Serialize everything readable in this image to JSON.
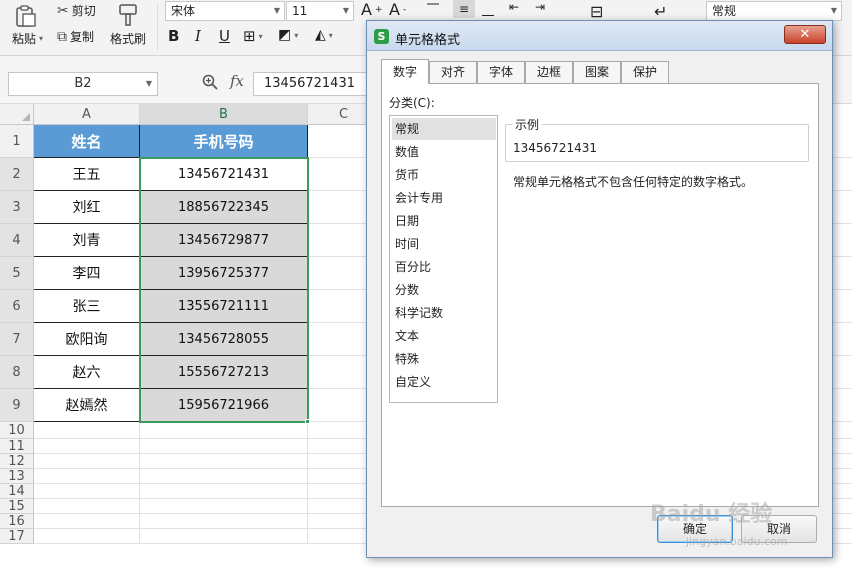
{
  "ribbon": {
    "paste": "粘贴",
    "cut": "剪切",
    "copy": "复制",
    "format_painter": "格式刷",
    "font_name": "宋体",
    "font_size": "11",
    "number_format": "常规"
  },
  "formula_bar": {
    "name_box": "B2",
    "fx": "fx",
    "value": "13456721431"
  },
  "columns": [
    "A",
    "B",
    "C"
  ],
  "rows": [
    "1",
    "2",
    "3",
    "4",
    "5",
    "6",
    "7",
    "8",
    "9",
    "10",
    "11",
    "12",
    "13",
    "14",
    "15",
    "16",
    "17"
  ],
  "table": {
    "headers": [
      "姓名",
      "手机号码"
    ],
    "rows": [
      [
        "王五",
        "13456721431"
      ],
      [
        "刘红",
        "18856722345"
      ],
      [
        "刘青",
        "13456729877"
      ],
      [
        "李四",
        "13956725377"
      ],
      [
        "张三",
        "13556721111"
      ],
      [
        "欧阳询",
        "13456728055"
      ],
      [
        "赵六",
        "15556727213"
      ],
      [
        "赵嫣然",
        "15956721966"
      ]
    ]
  },
  "dialog": {
    "title": "单元格格式",
    "close": "✕",
    "tabs": [
      "数字",
      "对齐",
      "字体",
      "边框",
      "图案",
      "保护"
    ],
    "category_label": "分类(C):",
    "categories": [
      "常规",
      "数值",
      "货币",
      "会计专用",
      "日期",
      "时间",
      "百分比",
      "分数",
      "科学记数",
      "文本",
      "特殊",
      "自定义"
    ],
    "sample_label": "示例",
    "sample_value": "13456721431",
    "description": "常规单元格格式不包含任何特定的数字格式。",
    "ok": "确定",
    "cancel": "取消"
  },
  "watermark": {
    "text": "Baidu 经验",
    "url": "jingyan.baidu.com"
  },
  "colors": {
    "header_fill": "#5b9bd5",
    "selection": "#3c9a5f",
    "phone_fill": "#d9d9d9"
  }
}
